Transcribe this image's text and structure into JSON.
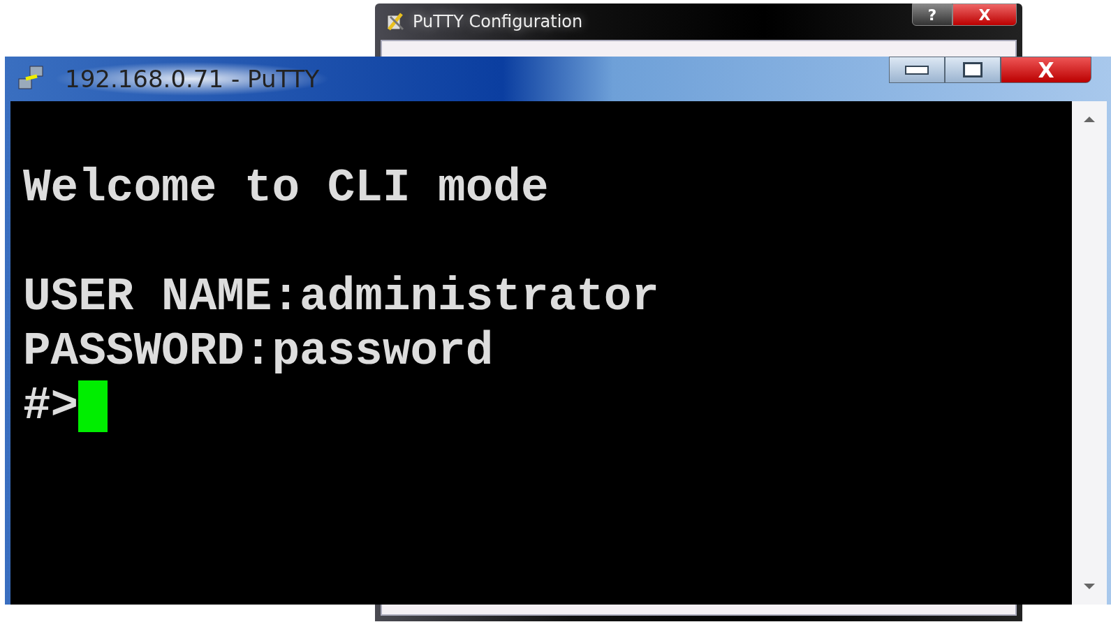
{
  "config_window": {
    "title": "PuTTY Configuration",
    "buttons": [
      {
        "kind": "help",
        "label": "?"
      },
      {
        "kind": "close",
        "label": "X"
      }
    ]
  },
  "terminal_window": {
    "title": "192.168.0.71 - PuTTY",
    "buttons": [
      {
        "kind": "minimize"
      },
      {
        "kind": "maximize"
      },
      {
        "kind": "close",
        "label": "X"
      }
    ],
    "banner": "Welcome to CLI mode",
    "login_lines": [
      "USER NAME:administrator",
      "PASSWORD:password"
    ],
    "prompt": "#>"
  }
}
